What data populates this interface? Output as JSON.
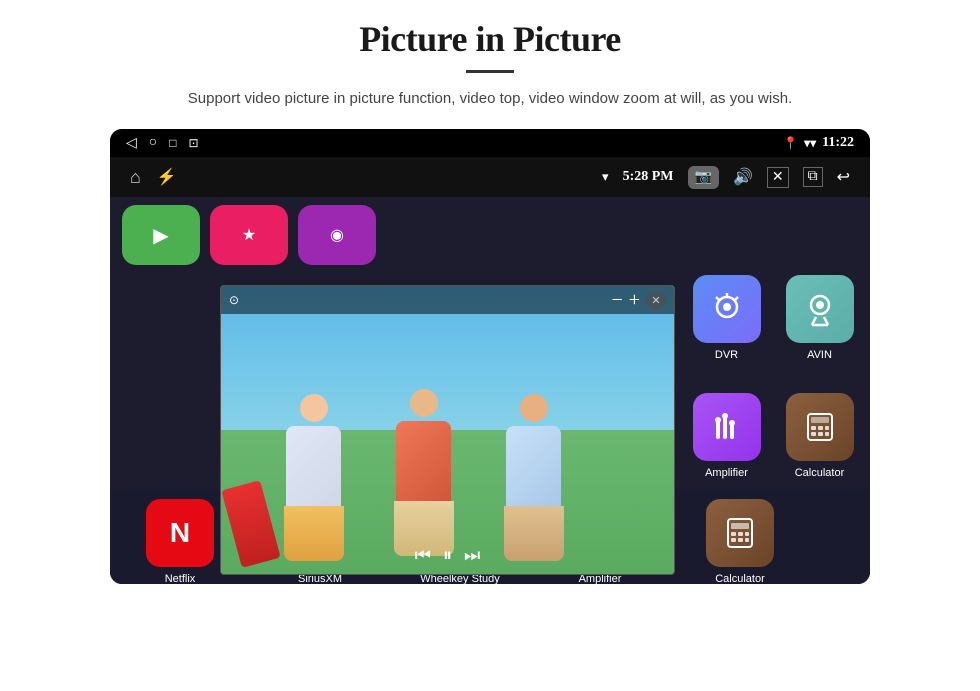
{
  "header": {
    "title": "Picture in Picture",
    "subtitle": "Support video picture in picture function, video top, video window zoom at will, as you wish."
  },
  "status_bar": {
    "time": "11:22",
    "nav_time": "5:28 PM"
  },
  "apps": {
    "dvr": {
      "label": "DVR",
      "color": "dvr"
    },
    "avin": {
      "label": "AVIN",
      "color": "avin"
    },
    "amplifier": {
      "label": "Amplifier",
      "color": "amp"
    },
    "calculator": {
      "label": "Calculator",
      "color": "calc"
    },
    "netflix": {
      "label": "Netflix"
    },
    "siriusxm": {
      "label": "SiriusXM"
    },
    "wheelkey": {
      "label": "Wheelkey Study"
    }
  },
  "pip": {
    "minus": "−",
    "plus": "+",
    "close": "✕"
  }
}
